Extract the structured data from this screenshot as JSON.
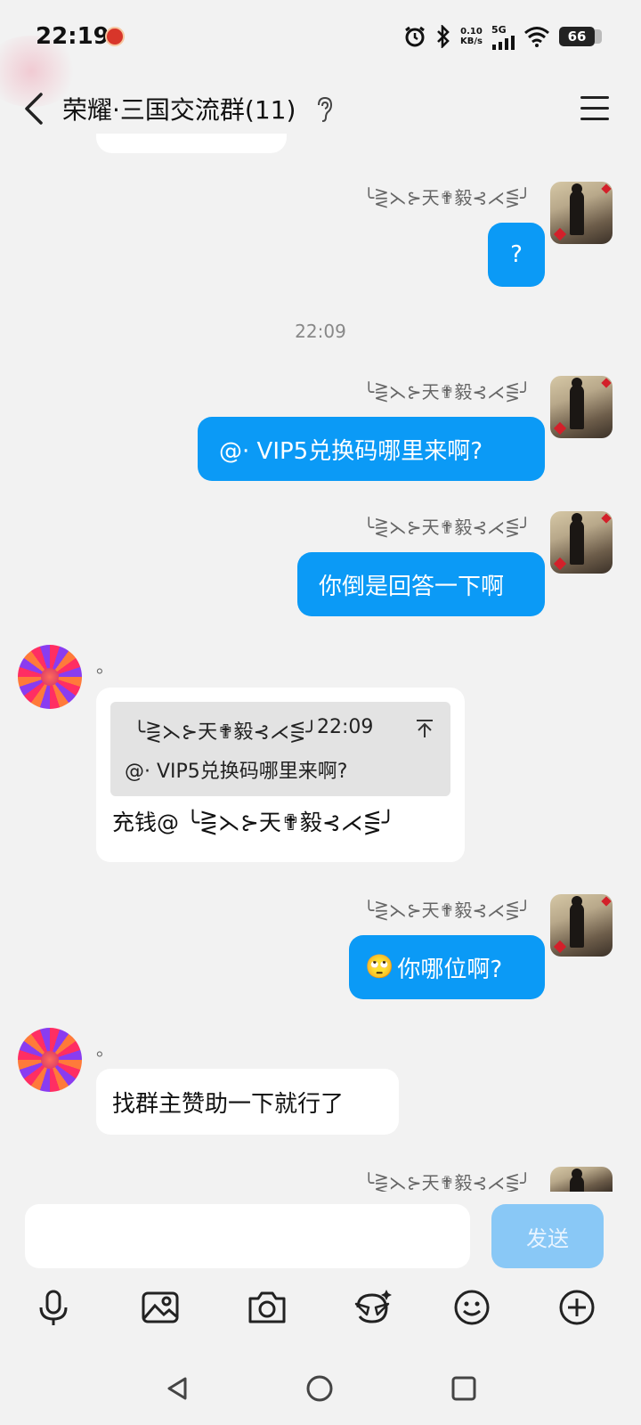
{
  "status_bar": {
    "time": "22:19",
    "net_speed_value": "0.10",
    "net_speed_unit": "KB/s",
    "network_type": "5G",
    "battery": "66",
    "icons": [
      "alarm-icon",
      "bluetooth-icon",
      "signal-icon",
      "wifi-icon",
      "battery-icon"
    ]
  },
  "header": {
    "title": "荣耀·三国交流群(11)",
    "icons": [
      "back-icon",
      "ear-icon",
      "menu-icon"
    ]
  },
  "chat": {
    "timestamp": "22:09",
    "messages": [
      {
        "side": "right",
        "nick": "╰⋛⋋⊱天✟毅⊰⋌⋚╯",
        "text": "?"
      },
      {
        "side": "right",
        "nick": "╰⋛⋋⊱天✟毅⊰⋌⋚╯",
        "text": "@· VIP5兑换码哪里来啊?"
      },
      {
        "side": "right",
        "nick": "╰⋛⋋⊱天✟毅⊰⋌⋚╯",
        "text": "你倒是回答一下啊"
      },
      {
        "side": "left",
        "nick": "。",
        "quote": {
          "nick": "╰⋛⋋⊱天✟毅⊰⋌⋚╯",
          "time": "22:09",
          "text": "@· VIP5兑换码哪里来啊?"
        },
        "text": "充钱@ ╰⋛⋋⊱天✟毅⊰⋌⋚╯"
      },
      {
        "side": "right",
        "nick": "╰⋛⋋⊱天✟毅⊰⋌⋚╯",
        "emoji": "🙄",
        "text": "你哪位啊?"
      },
      {
        "side": "left",
        "nick": "。",
        "text": "找群主赞助一下就行了"
      },
      {
        "side": "right",
        "nick": "╰⋛⋋⊱天✟毅⊰⋌⋚╯"
      }
    ]
  },
  "input": {
    "placeholder": "",
    "send_label": "发送"
  },
  "toolbar": [
    "microphone-icon",
    "image-icon",
    "camera-icon",
    "sticker-icon",
    "emoji-icon",
    "plus-icon"
  ],
  "navbar": [
    "nav-back-icon",
    "nav-home-icon",
    "nav-recents-icon"
  ],
  "colors": {
    "accent": "#0b9af6",
    "send_disabled": "#89c8f6",
    "background": "#f2f2f2"
  }
}
